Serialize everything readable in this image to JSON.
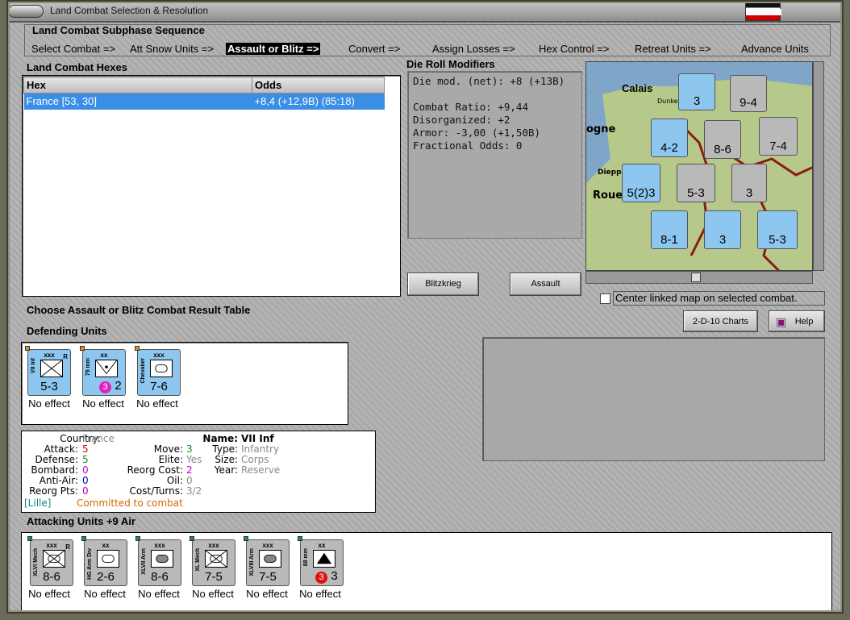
{
  "window": {
    "title": "Land Combat Selection & Resolution"
  },
  "sequence": {
    "title": "Land Combat Subphase Sequence",
    "items": [
      "Select Combat =>",
      "Att Snow Units =>",
      "Assault or Blitz =>",
      "Convert =>",
      "Assign Losses =>",
      "Hex Control =>",
      "Retreat Units =>",
      "Advance Units"
    ]
  },
  "hexes": {
    "title": "Land Combat Hexes",
    "col_hex": "Hex",
    "col_odds": "Odds",
    "rows": [
      {
        "hex": "France [53, 30]",
        "odds": "+8,4 (+12,9B) (85:18)"
      }
    ]
  },
  "modifiers": {
    "title": "Die Roll Modifiers",
    "lines": [
      "Die mod. (net): +8 (+13B)",
      "",
      "Combat Ratio: +9,44",
      "Disorganized: +2",
      "Armor: -3,00 (+1,50B)",
      "Fractional Odds: 0"
    ]
  },
  "buttons": {
    "blitz": "Blitzkrieg",
    "assault": "Assault",
    "charts": "2-D-10 Charts",
    "help": "Help"
  },
  "center_map": {
    "label": "Center linked map on selected combat.",
    "checked": false
  },
  "choose_label": "Choose Assault or Blitz Combat Result Table",
  "defending": {
    "title": "Defending Units",
    "units": [
      {
        "name": "VII Inf",
        "size": "xxx",
        "reserve": "R",
        "strength": "5-3",
        "type": "inf",
        "effect": "No effect"
      },
      {
        "name": "75 mm",
        "size": "xx",
        "reserve": "",
        "strength": "2",
        "badge": "3",
        "type": "art",
        "effect": "No effect"
      },
      {
        "name": "Chevalier",
        "size": "xxx",
        "reserve": "",
        "strength": "7-6",
        "type": "arm",
        "effect": "No effect"
      }
    ]
  },
  "unit_info": {
    "country_k": "Country:",
    "country": "France",
    "attack_k": "Attack:",
    "attack": "5",
    "defense_k": "Defense:",
    "defense": "5",
    "bombard_k": "Bombard:",
    "bombard": "0",
    "antiair_k": "Anti-Air:",
    "antiair": "0",
    "reorg_k": "Reorg Pts:",
    "reorg": "0",
    "move_k": "Move:",
    "move": "3",
    "elite_k": "Elite:",
    "elite": "Yes",
    "reorgcost_k": "Reorg Cost:",
    "reorgcost": "2",
    "oil_k": "Oil:",
    "oil": "0",
    "cost_k": "Cost/Turns:",
    "cost": "3/2",
    "name_k": "Name:",
    "name": "VII Inf",
    "type_k": "Type:",
    "type": "Infantry",
    "size_k": "Size:",
    "size": "Corps",
    "year_k": "Year:",
    "year": "Reserve",
    "location": "[Lille]",
    "status": "Committed to combat"
  },
  "attacking": {
    "title": "Attacking Units +9 Air",
    "units": [
      {
        "name": "XLVI Mech",
        "size": "xxx",
        "reserve": "R",
        "strength": "8-6",
        "type": "mech",
        "effect": "No effect"
      },
      {
        "name": "HG Arm Div",
        "size": "xx",
        "reserve": "",
        "strength": "2-6",
        "type": "arm",
        "effect": "No effect"
      },
      {
        "name": "XLVII Arm",
        "size": "xxx",
        "reserve": "",
        "strength": "8-6",
        "type": "arm",
        "effect": "No effect"
      },
      {
        "name": "XL Mech",
        "size": "xxx",
        "reserve": "",
        "strength": "7-5",
        "type": "mech",
        "effect": "No effect"
      },
      {
        "name": "XLVIII Arm",
        "size": "xxx",
        "reserve": "",
        "strength": "7-5",
        "type": "arm",
        "effect": "No effect"
      },
      {
        "name": "88 mm",
        "size": "xx",
        "reserve": "",
        "strength": "3",
        "badge": "3",
        "type": "aa",
        "effect": "No effect"
      }
    ]
  },
  "map": {
    "labels": [
      "Calais",
      "Dunkerque",
      "ogne",
      "Dieppe",
      "Roue"
    ],
    "counters": [
      {
        "txt": "4-2",
        "side": "fr"
      },
      {
        "txt": "8-6",
        "side": "ge"
      },
      {
        "txt": "7-4",
        "side": "ge"
      },
      {
        "txt": "5(2)3",
        "side": "fr"
      },
      {
        "txt": "5-3",
        "side": "fr"
      },
      {
        "txt": "3",
        "side": "ge"
      },
      {
        "txt": "8-1",
        "side": "fr"
      },
      {
        "txt": "3",
        "side": "fr"
      },
      {
        "txt": "5-3",
        "side": "fr"
      },
      {
        "txt": "9-4",
        "side": "ge"
      },
      {
        "txt": "3",
        "side": "fr"
      }
    ]
  }
}
